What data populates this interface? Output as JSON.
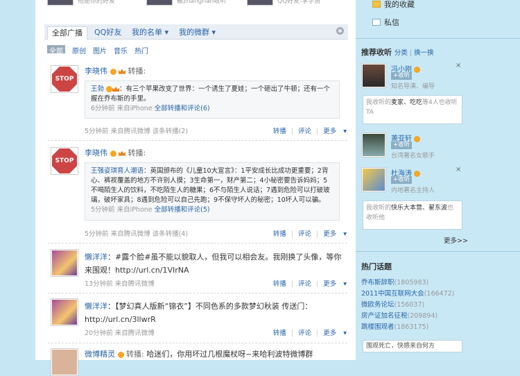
{
  "top": {
    "f1": "他是你的好友",
    "f2": "被zhangnan收听",
    "f3": "QQ好友-李学勇"
  },
  "tabs": [
    "全部广播",
    "QQ好友",
    "我的名单",
    "我的微群"
  ],
  "filters": [
    "全部",
    "原创",
    "图片",
    "音乐",
    "热门"
  ],
  "posts": [
    {
      "author": "李晓伟",
      "rt": "转播:",
      "quote": {
        "author": "王勃",
        "text": "：有三个苹果改变了世界：一个诱生了夏娃；一个砸出了牛顿；还有一个握在乔布斯的手里。",
        "time": "6分钟前 来自iPhone",
        "all": "全部转播和评论(6)"
      },
      "time": "5分钟前 来自腾讯微博 该条转播(2)"
    },
    {
      "author": "李晓伟",
      "rt": "转播:",
      "quote": {
        "author": "王强姿琪育人潮语",
        "text": "：英国颁布的《儿童10大宣言》：1平安成长比成功更重要；2背心、裤衩覆盖的地方不许别人摸；3生命第一，财产第二；4小秘密要告诉妈妈；5不喝陌生人的饮料，不吃陌生人的糖果；6不与陌生人说话；7遇到危险可以打破玻璃，破坏家具；8遇到危险可以自己先跑；9不保守坏人的秘密；10坏人可以骗。",
        "time": "5分钟前 来自iPhone",
        "all": "全部转播和评论(5)"
      },
      "time": "5分钟前 来自腾讯微博 该条转播(4)"
    },
    {
      "author": "懒洋洋",
      "text": "：#露个脸#虽不能以貌取人，但我可以相会友。我刚换了头像，等你来围观！http://url.cn/1VIrNA",
      "time": "13分钟前 来自腾讯微博"
    },
    {
      "author": "懒洋洋",
      "text": "：【梦幻真人版新“锦衣”】不同色系的多款梦幻秋装 传送门：http://url.cn/3llwrR",
      "time": "20分钟前 来自腾讯微博"
    },
    {
      "author": "微博精灵",
      "rt": "转播:",
      "text": "哈迷们，你用坏过几根魔杖呀~来哈利波特微博群"
    }
  ],
  "acts": {
    "rt": "转播",
    "cm": "评论",
    "more": "更多"
  },
  "side": {
    "fav": "我的收藏",
    "msg": "私信",
    "rec_title": "推荐收听",
    "rec_cat": "分类",
    "rec_swap": "换一换",
    "follow": "+收听",
    "recs": [
      {
        "name": "冯小刚",
        "desc": "知名导演、编导",
        "bubble": "我收听的",
        "bq": "麦家、吃吃",
        "bt": "等4人也收听TA"
      },
      {
        "name": "萧亚轩",
        "desc": "台湾著名女歌手"
      },
      {
        "name": "杜海涛",
        "desc": "内地著名主持人",
        "bubble": "我收听的",
        "bq": "快乐大本营、翟东波",
        "bt": "也收听他"
      }
    ],
    "more": "更多>>",
    "hot_title": "热门话题",
    "hot": [
      {
        "t": "乔布斯辞职",
        "n": "(1805983)"
      },
      {
        "t": "2011中国互联网大会",
        "n": "(166472)"
      },
      {
        "t": "微欧务论坛",
        "n": "(156037)"
      },
      {
        "t": "房产证加名征税",
        "n": "(209894)"
      },
      {
        "t": "跳楼围观者",
        "n": "(1863175)"
      }
    ],
    "hot_input": "围观死亡，快感来自何方"
  },
  "colors": {
    "link": "#2864a8",
    "side": "#c9e8f5"
  }
}
